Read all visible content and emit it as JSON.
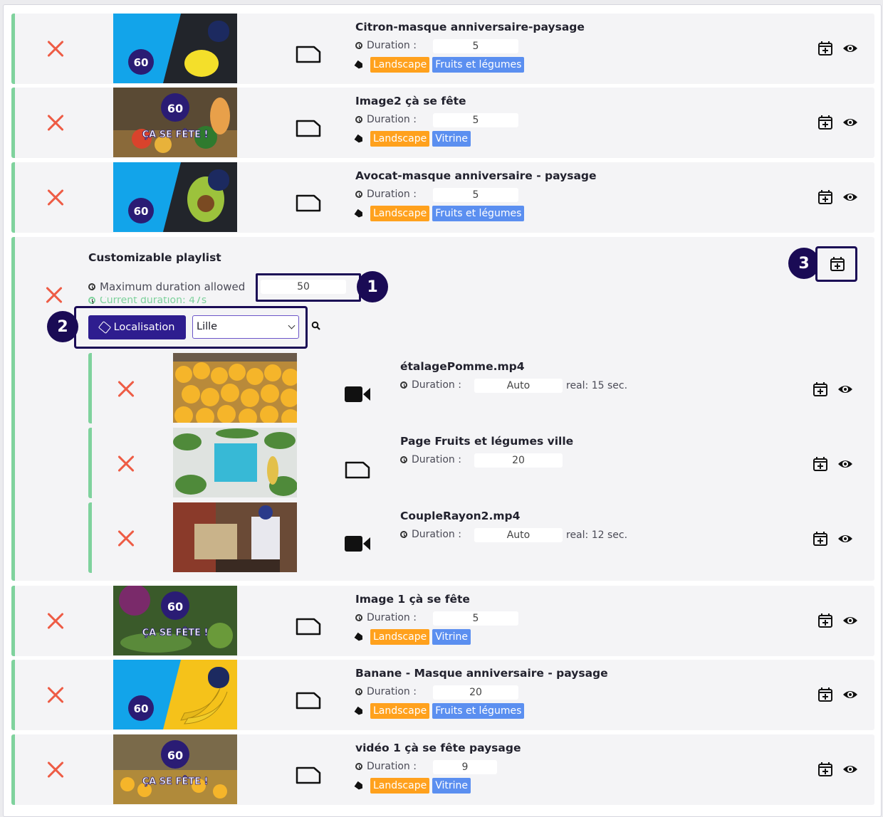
{
  "colors": {
    "accent": "#1a0b55",
    "delete": "#ee5c45",
    "bar": "#7fd29d",
    "tag_orange": "#ffa11d",
    "tag_blue": "#5b8ff0"
  },
  "icons": {
    "delete": "close-icon",
    "clock": "clock-icon",
    "tag": "tag-icon",
    "schedule": "calendar-plus-icon",
    "preview": "eye-icon",
    "image": "image-file-icon",
    "video": "video-camera-icon",
    "search": "search-icon"
  },
  "duration_label": "Duration :",
  "items_top": [
    {
      "title": "Citron-masque anniversaire-paysage",
      "duration": "5",
      "tags": [
        "Landscape",
        "Fruits et légumes"
      ]
    },
    {
      "title": "Image2 çà se fête",
      "duration": "5",
      "tags": [
        "Landscape",
        "Vitrine"
      ]
    },
    {
      "title": "Avocat-masque anniversaire - paysage",
      "duration": "5",
      "tags": [
        "Landscape",
        "Fruits et légumes"
      ]
    }
  ],
  "playlist": {
    "title": "Customizable playlist",
    "max_label": "Maximum duration allowed",
    "max_value": "50",
    "current": "Current duration: 47s",
    "filter_button": "Localisation",
    "filter_value": "Lille",
    "callouts": [
      "1",
      "2",
      "3"
    ],
    "items": [
      {
        "title": "étalagePomme.mp4",
        "duration": "Auto",
        "real": "real: 15 sec."
      },
      {
        "title": "Page Fruits et légumes ville",
        "duration": "20",
        "real": ""
      },
      {
        "title": "CoupleRayon2.mp4",
        "duration": "Auto",
        "real": "real: 12 sec."
      }
    ]
  },
  "items_bottom": [
    {
      "title": "Image 1 çà se fête",
      "duration": "5",
      "tags": [
        "Landscape",
        "Vitrine"
      ]
    },
    {
      "title": "Banane - Masque anniversaire - paysage",
      "duration": "20",
      "tags": [
        "Landscape",
        "Fruits et légumes"
      ]
    },
    {
      "title": "vidéo 1 çà se fête paysage",
      "duration": "9",
      "tags": [
        "Landscape",
        "Vitrine"
      ]
    }
  ]
}
